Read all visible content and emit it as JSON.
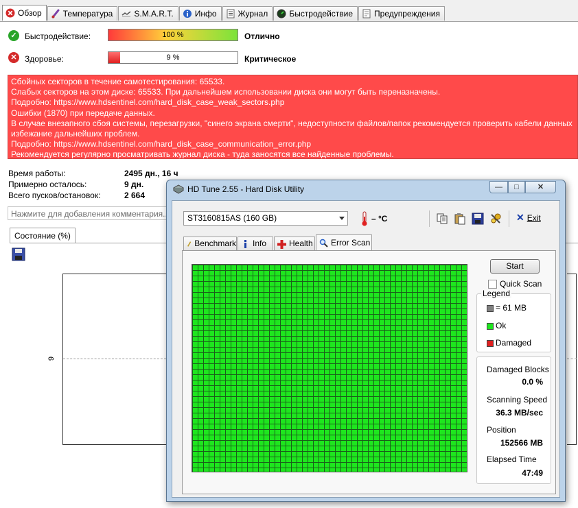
{
  "main_tabs": [
    {
      "label": "Обзор",
      "icon": "error-icon",
      "active": true
    },
    {
      "label": "Температура",
      "icon": "thermometer-icon"
    },
    {
      "label": "S.M.A.R.T.",
      "icon": "smart-icon"
    },
    {
      "label": "Инфо",
      "icon": "info-icon"
    },
    {
      "label": "Журнал",
      "icon": "log-icon"
    },
    {
      "label": "Быстродействие",
      "icon": "performance-icon"
    },
    {
      "label": "Предупреждения",
      "icon": "alerts-icon"
    }
  ],
  "overview": {
    "performance": {
      "label": "Быстродействие:",
      "percent_text": "100 %",
      "percent": 100,
      "verdict": "Отлично",
      "icon": "check-icon",
      "color": "#2aa52a"
    },
    "health": {
      "label": "Здоровье:",
      "percent_text": "9 %",
      "percent": 9,
      "verdict": "Критическое",
      "icon": "error-icon",
      "color": "#e03030"
    },
    "messages": [
      "Сбойных секторов в течение самотестирования: 65533.",
      "Слабых секторов на этом диске: 65533. При дальнейшем использовании диска они могут быть переназначены.",
      "Подробно: https://www.hdsentinel.com/hard_disk_case_weak_sectors.php",
      "Ошибки (1870) при передаче данных.",
      "В случае внезапного сбоя системы, перезагрузки, \"синего экрана смерти\", недоступности файлов/папок рекомендуется проверить кабели данных",
      "избежание дальнейших проблем.",
      "Подробно: https://www.hdsentinel.com/hard_disk_case_communication_error.php",
      "Рекомендуется регулярно просматривать журнал диска - туда заносятся все найденные проблемы."
    ],
    "stats": [
      {
        "label": "Время работы:",
        "value": "2495 дн., 16 ч"
      },
      {
        "label": "Примерно осталось:",
        "value": "9 дн."
      },
      {
        "label": "Всего пусков/остановок:",
        "value": "2 664"
      }
    ],
    "comment_placeholder": "Нажмите для добавления комментария...",
    "state_tab": "Состояние (%)",
    "chart_y_tick": "9"
  },
  "hdtune": {
    "title": "HD Tune 2.55 - Hard Disk Utility",
    "drive": "ST3160815AS (160 GB)",
    "temperature": "– °C",
    "exit_label": "Exit",
    "tabs": [
      "Benchmark",
      "Info",
      "Health",
      "Error Scan"
    ],
    "active_tab": "Error Scan",
    "start_label": "Start",
    "quick_scan_label": "Quick Scan",
    "legend": {
      "title": "Legend",
      "block": "= 61 MB",
      "ok": "Ok",
      "damaged": "Damaged",
      "colors": {
        "block": "#808080",
        "ok": "#1ee61e",
        "damaged": "#e02020"
      }
    },
    "stats": {
      "damaged_blocks_label": "Damaged Blocks",
      "damaged_blocks_value": "0.0 %",
      "scanning_speed_label": "Scanning Speed",
      "scanning_speed_value": "36.3 MB/sec",
      "position_label": "Position",
      "position_value": "152566 MB",
      "elapsed_label": "Elapsed Time",
      "elapsed_value": "47:49"
    }
  }
}
